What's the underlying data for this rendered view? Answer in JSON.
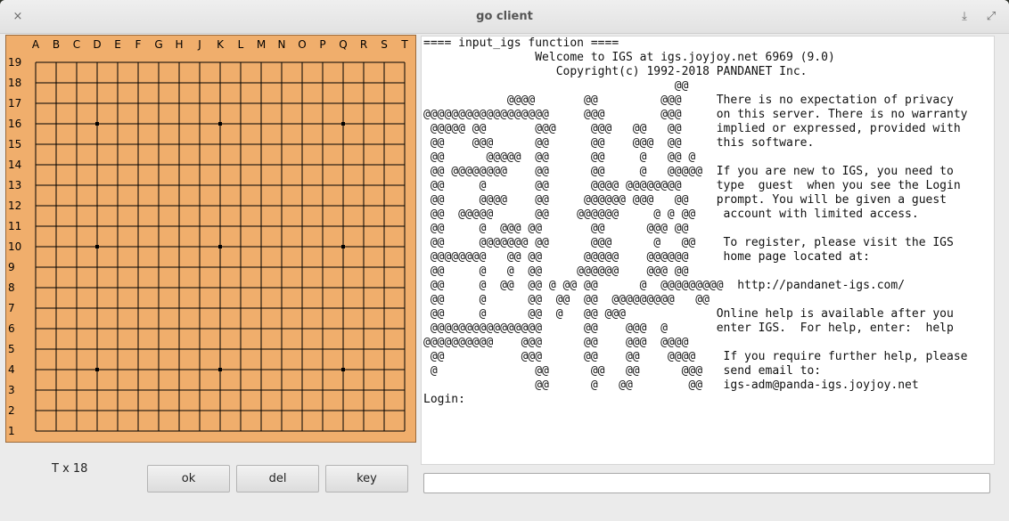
{
  "window": {
    "title": "go client",
    "close_glyph": "×",
    "download_glyph": "⤓",
    "expand_glyph": "⤢"
  },
  "board": {
    "size": 19,
    "columns": [
      "A",
      "B",
      "C",
      "D",
      "E",
      "F",
      "G",
      "H",
      "J",
      "K",
      "L",
      "M",
      "N",
      "O",
      "P",
      "Q",
      "R",
      "S",
      "T"
    ],
    "rows": [
      "19",
      "18",
      "17",
      "16",
      "15",
      "14",
      "13",
      "12",
      "11",
      "10",
      "9",
      "8",
      "7",
      "6",
      "5",
      "4",
      "3",
      "2",
      "1"
    ],
    "star_points": [
      "D16",
      "K16",
      "Q16",
      "D10",
      "K10",
      "Q10",
      "D4",
      "K4",
      "Q4"
    ],
    "colors": {
      "wood": "#f0ae6c",
      "line": "#000000"
    }
  },
  "console": {
    "lines": [
      "==== input_igs function ====",
      "                Welcome to IGS at igs.joyjoy.net 6969 (9.0)",
      "                   Copyright(c) 1992-2018 PANDANET Inc.",
      "                                    @@",
      "            @@@@       @@         @@@     There is no expectation of privacy",
      "@@@@@@@@@@@@@@@@@@     @@@        @@@     on this server. There is no warranty",
      " @@@@@ @@       @@@     @@@   @@   @@     implied or expressed, provided with",
      " @@    @@@      @@      @@    @@@  @@     this software.",
      " @@      @@@@@  @@      @@     @   @@ @",
      " @@ @@@@@@@@    @@      @@     @   @@@@@  If you are new to IGS, you need to",
      " @@     @       @@      @@@@ @@@@@@@@     type  guest  when you see the Login",
      " @@     @@@@    @@     @@@@@@ @@@   @@    prompt. You will be given a guest",
      " @@  @@@@@      @@    @@@@@@     @ @ @@    account with limited access.",
      " @@     @  @@@ @@       @@      @@@ @@",
      " @@     @@@@@@@ @@      @@@      @   @@    To register, please visit the IGS",
      " @@@@@@@@   @@ @@      @@@@@    @@@@@@     home page located at:",
      " @@     @   @  @@     @@@@@@    @@@ @@",
      " @@     @  @@  @@ @ @@ @@      @  @@@@@@@@@  http://pandanet-igs.com/",
      " @@     @      @@  @@  @@  @@@@@@@@@   @@",
      " @@     @      @@  @   @@ @@@             Online help is available after you",
      " @@@@@@@@@@@@@@@@      @@    @@@  @       enter IGS.  For help, enter:  help",
      "@@@@@@@@@@    @@@      @@    @@@  @@@@",
      " @@           @@@      @@    @@    @@@@    If you require further help, please",
      " @              @@      @@   @@      @@@   send email to:",
      "                @@      @   @@        @@   igs-adm@panda-igs.joyjoy.net",
      "Login:"
    ],
    "input_value": ""
  },
  "status": {
    "text": "T x 18"
  },
  "buttons": {
    "ok": "ok",
    "del": "del",
    "key": "key"
  }
}
